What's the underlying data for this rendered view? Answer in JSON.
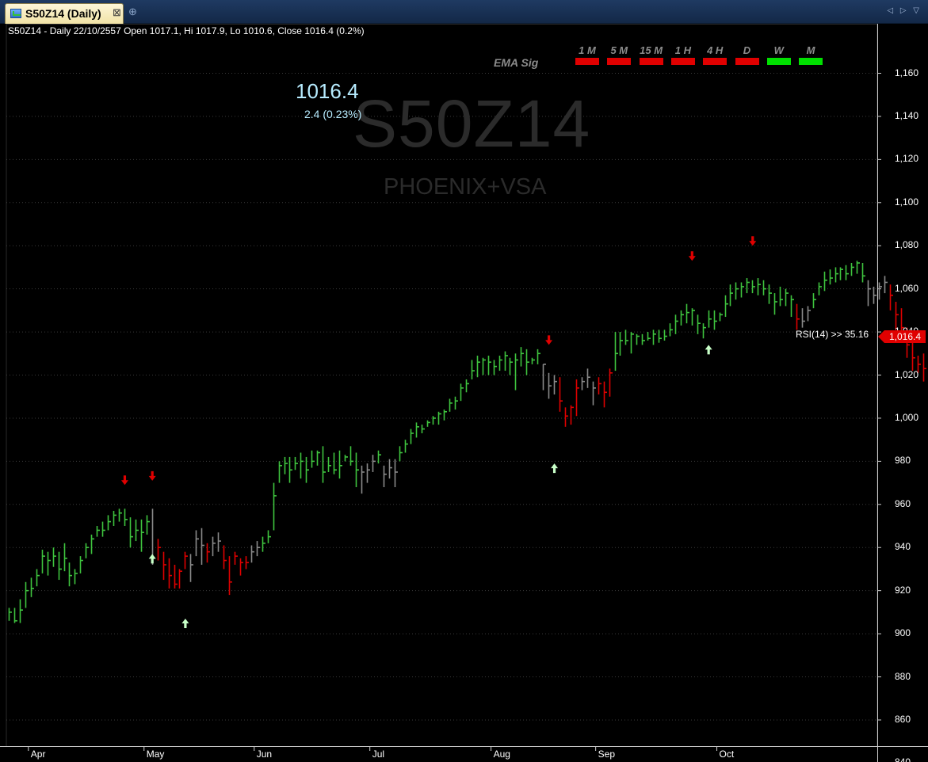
{
  "tab": {
    "title": "S50Z14 (Daily)",
    "close_glyph": "⊠",
    "new_tab_glyph": "⊕",
    "nav_glyph": "◁ ▷ ▽"
  },
  "header": {
    "text": "S50Z14 - Daily 22/10/2557 Open 1017.1, Hi 1017.9, Lo 1010.6, Close 1016.4 (0.2%)"
  },
  "watermark": {
    "symbol": "S50Z14",
    "system": "PHOENIX+VSA"
  },
  "quote": {
    "last": "1016.4",
    "change": "2.4 (0.23%)"
  },
  "ema_panel": {
    "label": "EMA Sig",
    "timeframes": [
      {
        "label": "1 M",
        "signal": "red"
      },
      {
        "label": "5 M",
        "signal": "red"
      },
      {
        "label": "15 M",
        "signal": "red"
      },
      {
        "label": "1 H",
        "signal": "red"
      },
      {
        "label": "4 H",
        "signal": "red"
      },
      {
        "label": "D",
        "signal": "red"
      },
      {
        "label": "W",
        "signal": "green"
      },
      {
        "label": "M",
        "signal": "green"
      }
    ]
  },
  "rsi": {
    "text": "RSI(14) >> 35.16"
  },
  "price_tag": {
    "text": "1,016.4"
  },
  "colors": {
    "up": "#3fc53f",
    "down": "#e00000",
    "neutral": "#8a8a8a",
    "buy_arrow": "#c8ffc8",
    "sell_arrow": "#e00000",
    "grid": "#3a3a3a"
  },
  "chart_data": {
    "type": "ohlc",
    "ylim": [
      830,
      1165
    ],
    "yticks": [
      "1,160",
      "1,140",
      "1,120",
      "1,100",
      "1,080",
      "1,060",
      "1,040",
      "1,020",
      "1,000",
      "980",
      "960",
      "940",
      "920",
      "900",
      "880",
      "860",
      "840"
    ],
    "ytick_values": [
      1160,
      1140,
      1120,
      1100,
      1080,
      1060,
      1040,
      1020,
      1000,
      980,
      960,
      940,
      920,
      900,
      880,
      860,
      840
    ],
    "months": [
      {
        "label": "Apr",
        "bar": 4
      },
      {
        "label": "May",
        "bar": 25
      },
      {
        "label": "Jun",
        "bar": 45
      },
      {
        "label": "Jul",
        "bar": 66
      },
      {
        "label": "Aug",
        "bar": 88
      },
      {
        "label": "Sep",
        "bar": 107
      },
      {
        "label": "Oct",
        "bar": 129
      }
    ],
    "bars": [
      [
        910,
        906,
        912,
        "g"
      ],
      [
        906,
        905,
        912,
        "g"
      ],
      [
        911,
        905,
        916,
        "g"
      ],
      [
        920,
        912,
        924,
        "g"
      ],
      [
        921,
        917,
        926,
        "g"
      ],
      [
        927,
        922,
        930,
        "g"
      ],
      [
        936,
        928,
        939,
        "g"
      ],
      [
        934,
        927,
        938,
        "g"
      ],
      [
        936,
        931,
        940,
        "g"
      ],
      [
        930,
        925,
        938,
        "g"
      ],
      [
        935,
        929,
        942,
        "g"
      ],
      [
        927,
        922,
        933,
        "g"
      ],
      [
        928,
        923,
        930,
        "g"
      ],
      [
        934,
        928,
        936,
        "g"
      ],
      [
        940,
        935,
        942,
        "g"
      ],
      [
        944,
        937,
        946,
        "g"
      ],
      [
        948,
        945,
        950,
        "g"
      ],
      [
        948,
        945,
        952,
        "g"
      ],
      [
        952,
        948,
        955,
        "g"
      ],
      [
        955,
        950,
        957,
        "g"
      ],
      [
        956,
        952,
        958,
        "g"
      ],
      [
        953,
        950,
        958,
        "g"
      ],
      [
        945,
        940,
        954,
        "g"
      ],
      [
        948,
        943,
        953,
        "g"
      ],
      [
        947,
        938,
        953,
        "g"
      ],
      [
        952,
        946,
        955,
        "g"
      ],
      [
        935,
        932,
        958,
        "n"
      ],
      [
        940,
        934,
        944,
        "r"
      ],
      [
        932,
        925,
        938,
        "r"
      ],
      [
        927,
        921,
        935,
        "r"
      ],
      [
        923,
        921,
        932,
        "r"
      ],
      [
        929,
        921,
        930,
        "r"
      ],
      [
        936,
        930,
        938,
        "r"
      ],
      [
        932,
        924,
        937,
        "n"
      ],
      [
        944,
        936,
        948,
        "n"
      ],
      [
        941,
        932,
        949,
        "n"
      ],
      [
        938,
        933,
        942,
        "r"
      ],
      [
        942,
        936,
        945,
        "n"
      ],
      [
        943,
        938,
        947,
        "n"
      ],
      [
        934,
        930,
        941,
        "r"
      ],
      [
        924,
        918,
        936,
        "r"
      ],
      [
        936,
        932,
        938,
        "r"
      ],
      [
        933,
        927,
        935,
        "r"
      ],
      [
        933,
        930,
        936,
        "r"
      ],
      [
        938,
        933,
        941,
        "n"
      ],
      [
        940,
        936,
        943,
        "n"
      ],
      [
        942,
        938,
        945,
        "g"
      ],
      [
        945,
        942,
        948,
        "g"
      ],
      [
        964,
        948,
        970,
        "g"
      ],
      [
        978,
        970,
        980,
        "g"
      ],
      [
        979,
        974,
        982,
        "g"
      ],
      [
        976,
        970,
        982,
        "g"
      ],
      [
        979,
        976,
        982,
        "g"
      ],
      [
        980,
        972,
        984,
        "g"
      ],
      [
        976,
        970,
        982,
        "g"
      ],
      [
        980,
        977,
        985,
        "g"
      ],
      [
        984,
        978,
        985,
        "g"
      ],
      [
        975,
        970,
        987,
        "g"
      ],
      [
        978,
        975,
        982,
        "g"
      ],
      [
        976,
        974,
        984,
        "g"
      ],
      [
        978,
        972,
        985,
        "g"
      ],
      [
        982,
        980,
        983,
        "g"
      ],
      [
        980,
        978,
        987,
        "g"
      ],
      [
        976,
        968,
        984,
        "g"
      ],
      [
        975,
        965,
        978,
        "n"
      ],
      [
        976,
        970,
        979,
        "n"
      ],
      [
        980,
        975,
        983,
        "n"
      ],
      [
        983,
        979,
        985,
        "g"
      ],
      [
        974,
        968,
        978,
        "n"
      ],
      [
        977,
        972,
        981,
        "n"
      ],
      [
        975,
        968,
        981,
        "n"
      ],
      [
        984,
        980,
        987,
        "g"
      ],
      [
        988,
        984,
        990,
        "g"
      ],
      [
        993,
        988,
        995,
        "g"
      ],
      [
        996,
        991,
        998,
        "g"
      ],
      [
        995,
        993,
        997,
        "g"
      ],
      [
        998,
        996,
        999,
        "g"
      ],
      [
        1000,
        997,
        1001,
        "g"
      ],
      [
        1002,
        997,
        1003,
        "g"
      ],
      [
        1003,
        999,
        1004,
        "g"
      ],
      [
        1007,
        1003,
        1009,
        "g"
      ],
      [
        1008,
        1004,
        1010,
        "g"
      ],
      [
        1014,
        1008,
        1016,
        "g"
      ],
      [
        1016,
        1012,
        1018,
        "g"
      ],
      [
        1022,
        1018,
        1027,
        "g"
      ],
      [
        1026,
        1019,
        1029,
        "g"
      ],
      [
        1027,
        1020,
        1028,
        "g"
      ],
      [
        1026,
        1020,
        1029,
        "g"
      ],
      [
        1024,
        1020,
        1027,
        "g"
      ],
      [
        1027,
        1022,
        1029,
        "g"
      ],
      [
        1029,
        1022,
        1031,
        "g"
      ],
      [
        1026,
        1020,
        1028,
        "g"
      ],
      [
        1027,
        1013,
        1030,
        "g"
      ],
      [
        1030,
        1024,
        1033,
        "g"
      ],
      [
        1026,
        1020,
        1032,
        "g"
      ],
      [
        1027,
        1025,
        1028,
        "g"
      ],
      [
        1030,
        1025,
        1032,
        "g"
      ],
      [
        1025,
        1013,
        1025,
        "n"
      ],
      [
        1015,
        1009,
        1021,
        "n"
      ],
      [
        1017,
        1011,
        1020,
        "n"
      ],
      [
        1008,
        1003,
        1019,
        "r"
      ],
      [
        1001,
        996,
        1005,
        "r"
      ],
      [
        1005,
        997,
        1006,
        "r"
      ],
      [
        1014,
        1001,
        1018,
        "r"
      ],
      [
        1017,
        1013,
        1019,
        "n"
      ],
      [
        1019,
        1014,
        1023,
        "n"
      ],
      [
        1014,
        1006,
        1017,
        "n"
      ],
      [
        1016,
        1011,
        1019,
        "r"
      ],
      [
        1012,
        1005,
        1017,
        "r"
      ],
      [
        1021,
        1010,
        1023,
        "r"
      ],
      [
        1030,
        1022,
        1040,
        "g"
      ],
      [
        1036,
        1029,
        1040,
        "g"
      ],
      [
        1036,
        1034,
        1041,
        "g"
      ],
      [
        1039,
        1030,
        1040,
        "g"
      ],
      [
        1038,
        1034,
        1039,
        "g"
      ],
      [
        1036,
        1034,
        1039,
        "g"
      ],
      [
        1037,
        1036,
        1040,
        "g"
      ],
      [
        1039,
        1034,
        1041,
        "g"
      ],
      [
        1037,
        1035,
        1041,
        "g"
      ],
      [
        1038,
        1036,
        1041,
        "g"
      ],
      [
        1041,
        1038,
        1044,
        "g"
      ],
      [
        1045,
        1039,
        1048,
        "g"
      ],
      [
        1048,
        1043,
        1050,
        "g"
      ],
      [
        1049,
        1044,
        1053,
        "g"
      ],
      [
        1050,
        1043,
        1051,
        "g"
      ],
      [
        1044,
        1039,
        1048,
        "g"
      ],
      [
        1042,
        1037,
        1044,
        "g"
      ],
      [
        1046,
        1042,
        1050,
        "g"
      ],
      [
        1045,
        1041,
        1050,
        "g"
      ],
      [
        1048,
        1045,
        1049,
        "g"
      ],
      [
        1053,
        1047,
        1057,
        "g"
      ],
      [
        1058,
        1052,
        1062,
        "g"
      ],
      [
        1060,
        1055,
        1063,
        "g"
      ],
      [
        1061,
        1056,
        1063,
        "g"
      ],
      [
        1063,
        1058,
        1065,
        "g"
      ],
      [
        1061,
        1058,
        1064,
        "g"
      ],
      [
        1062,
        1057,
        1065,
        "g"
      ],
      [
        1060,
        1057,
        1064,
        "g"
      ],
      [
        1058,
        1053,
        1062,
        "g"
      ],
      [
        1054,
        1048,
        1058,
        "g"
      ],
      [
        1055,
        1052,
        1061,
        "g"
      ],
      [
        1058,
        1052,
        1060,
        "g"
      ],
      [
        1055,
        1047,
        1057,
        "g"
      ],
      [
        1046,
        1041,
        1053,
        "r"
      ],
      [
        1045,
        1042,
        1051,
        "n"
      ],
      [
        1050,
        1045,
        1052,
        "n"
      ],
      [
        1055,
        1051,
        1058,
        "g"
      ],
      [
        1061,
        1057,
        1063,
        "g"
      ],
      [
        1064,
        1059,
        1068,
        "g"
      ],
      [
        1065,
        1062,
        1069,
        "g"
      ],
      [
        1067,
        1063,
        1070,
        "g"
      ],
      [
        1069,
        1064,
        1070,
        "g"
      ],
      [
        1067,
        1064,
        1071,
        "g"
      ],
      [
        1070,
        1066,
        1072,
        "g"
      ],
      [
        1072,
        1067,
        1073,
        "g"
      ],
      [
        1066,
        1063,
        1072,
        "g"
      ],
      [
        1060,
        1052,
        1064,
        "n"
      ],
      [
        1057,
        1053,
        1061,
        "n"
      ],
      [
        1061,
        1055,
        1063,
        "n"
      ],
      [
        1063,
        1058,
        1066,
        "n"
      ],
      [
        1057,
        1050,
        1062,
        "r"
      ],
      [
        1048,
        1041,
        1054,
        "r"
      ],
      [
        1042,
        1036,
        1051,
        "r"
      ],
      [
        1034,
        1028,
        1042,
        "r"
      ],
      [
        1028,
        1022,
        1035,
        "r"
      ],
      [
        1025,
        1021,
        1029,
        "r"
      ],
      [
        1023,
        1017,
        1030,
        "r"
      ],
      [
        1034,
        1029,
        1037,
        "r"
      ],
      [
        1026,
        1020,
        1035,
        "r"
      ],
      [
        1023,
        1021,
        1031,
        "r"
      ],
      [
        1021,
        1020,
        1025,
        "r"
      ],
      [
        1023,
        1018,
        1026,
        "r"
      ],
      [
        1022,
        1016,
        1030,
        "r"
      ],
      [
        1018,
        1015,
        1026,
        "r"
      ],
      [
        1013,
        1009,
        1021,
        "r"
      ],
      [
        1014,
        1011,
        1022,
        "r"
      ],
      [
        1011,
        1006,
        1016,
        "r"
      ],
      [
        1016,
        1011,
        1018,
        "r"
      ]
    ],
    "buy_signals": [
      {
        "bar": 26,
        "price": 937
      },
      {
        "bar": 32,
        "price": 907
      },
      {
        "bar": 99,
        "price": 979
      },
      {
        "bar": 127,
        "price": 1034
      }
    ],
    "sell_signals": [
      {
        "bar": 21,
        "price": 969
      },
      {
        "bar": 26,
        "price": 971
      },
      {
        "bar": 98,
        "price": 1034
      },
      {
        "bar": 124,
        "price": 1073
      },
      {
        "bar": 135,
        "price": 1080
      }
    ]
  }
}
